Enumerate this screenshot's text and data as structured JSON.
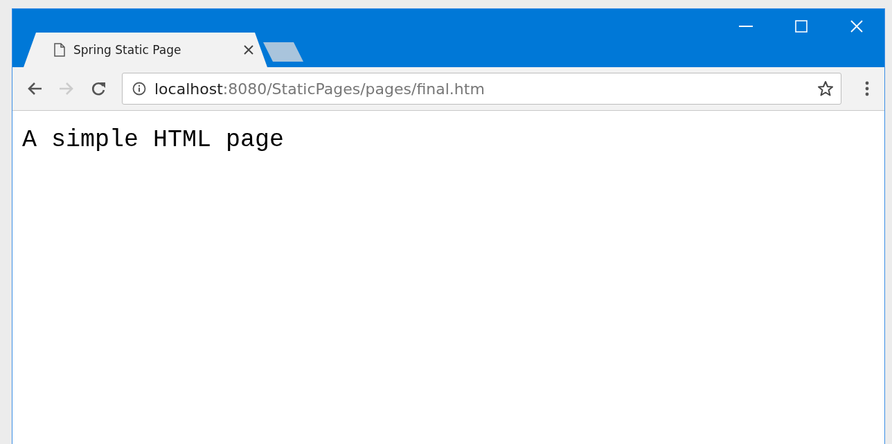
{
  "tabs": [
    {
      "title": "Spring Static Page",
      "selected": true
    }
  ],
  "address_bar": {
    "host": "localhost",
    "path": ":8080/StaticPages/pages/final.htm"
  },
  "page": {
    "text": "A simple HTML page"
  }
}
